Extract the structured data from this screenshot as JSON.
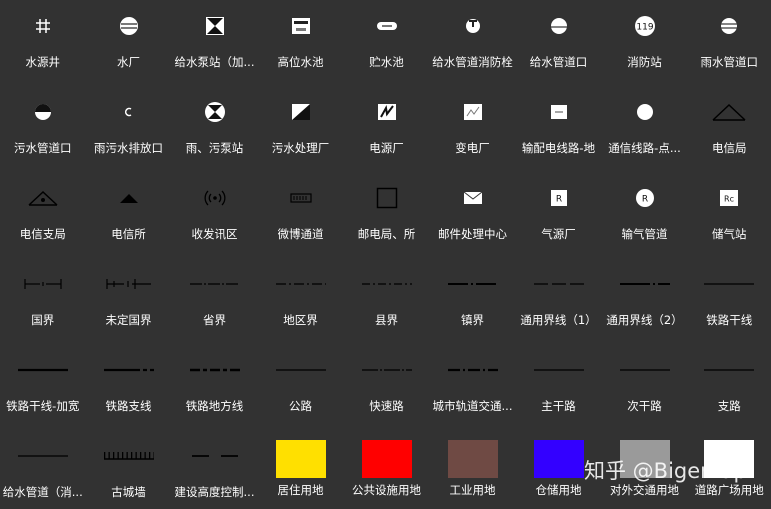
{
  "labels": {
    "r1": [
      "水源井",
      "水厂",
      "给水泵站（加...",
      "高位水池",
      "贮水池",
      "给水管道消防栓",
      "给水管道口",
      "消防站",
      "雨水管道口"
    ],
    "r2": [
      "污水管道口",
      "雨污水排放口",
      "雨、污泵站",
      "污水处理厂",
      "电源厂",
      "变电厂",
      "输配电线路-地",
      "通信线路-点...",
      "电信局"
    ],
    "r3": [
      "电信支局",
      "电信所",
      "收发讯区",
      "微博通道",
      "邮电局、所",
      "邮件处理中心",
      "气源厂",
      "输气管道",
      "储气站"
    ],
    "r4": [
      "国界",
      "未定国界",
      "省界",
      "地区界",
      "县界",
      "镇界",
      "通用界线（1）",
      "通用界线（2）",
      "铁路干线"
    ],
    "r5": [
      "铁路干线-加宽",
      "铁路支线",
      "铁路地方线",
      "公路",
      "快速路",
      "城市轨道交通...",
      "主干路",
      "次干路",
      "支路"
    ],
    "r6": [
      "给水管道（消...",
      "古城墙",
      "建设高度控制...",
      "居住用地",
      "公共设施用地",
      "工业用地",
      "仓储用地",
      "对外交通用地",
      "道路广场用地"
    ]
  },
  "symbol_text": {
    "fire_station": "119",
    "gas_source": "R",
    "gas_pipeline": "R",
    "gas_storage": "Rc"
  },
  "swatch_colors": {
    "residential": "#FFE000",
    "public": "#FF0000",
    "industrial": "#6F4A44",
    "storage": "#3300FF",
    "transport": "#9A9A9A",
    "road_square": "#FFFFFF"
  },
  "watermark": "知乎 @Bigemap"
}
